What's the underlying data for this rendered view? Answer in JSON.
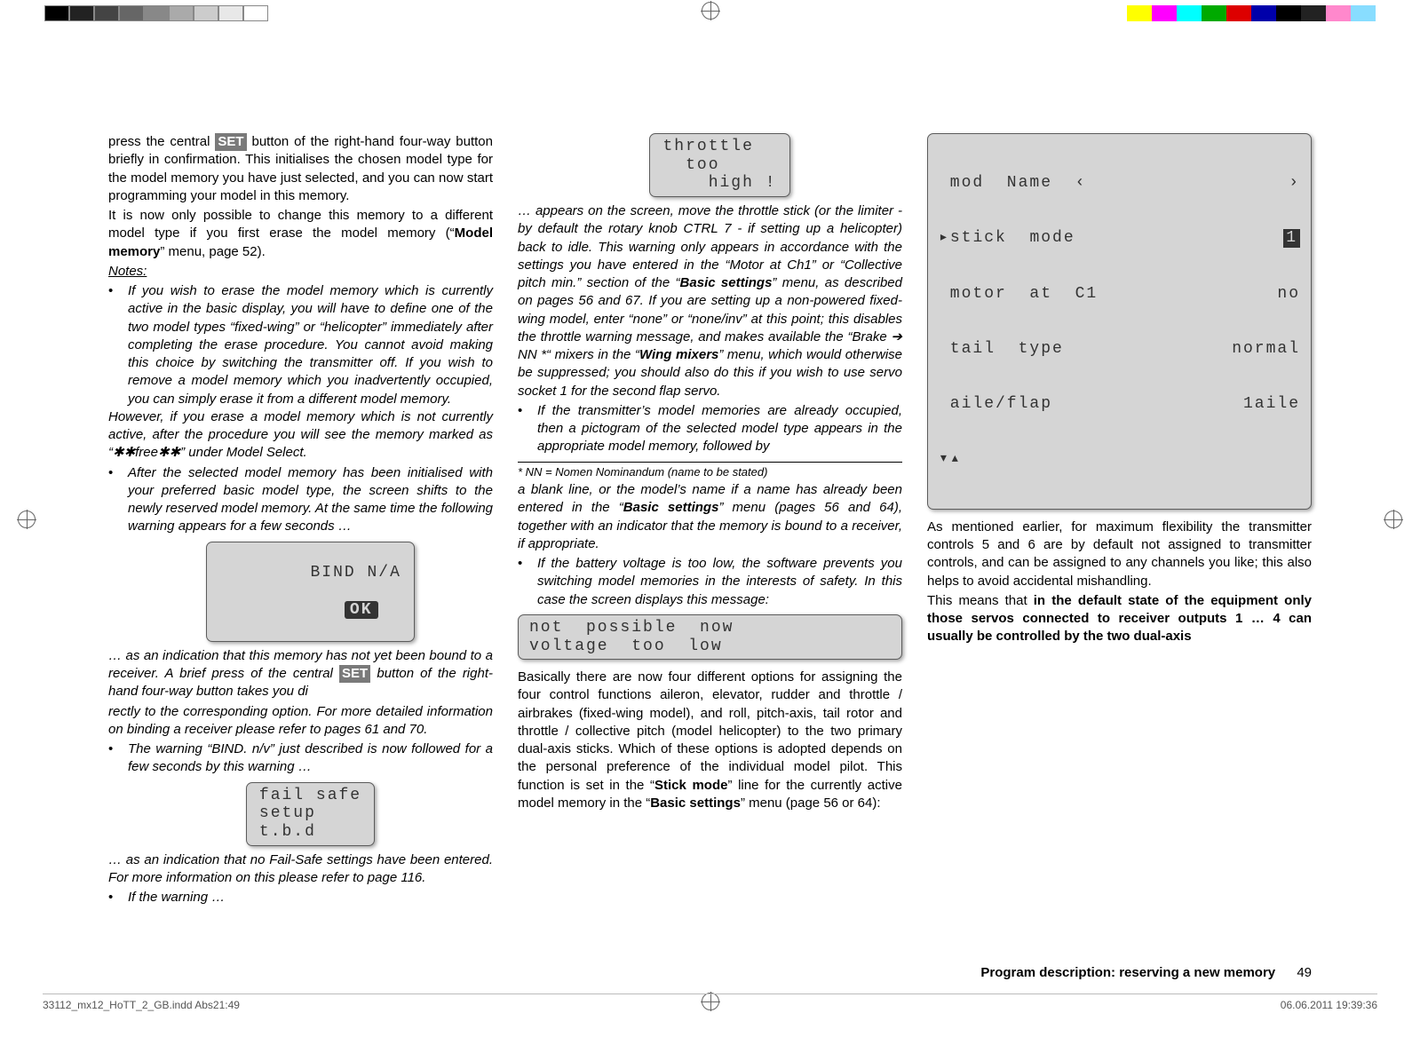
{
  "col1": {
    "p1a": "press the central ",
    "set": "SET",
    "p1b": " button of the right-hand four-way button briefly in confirmation. This initialises the chosen model type for the model memory you have just selected, and you can now start programming your model in this memory.",
    "p2a": "It is now only possible to change this memory to a different model type if you first erase the model memory (“",
    "p2b": "Model memory",
    "p2c": "” menu, page 52).",
    "notes": "Notes:",
    "n1": "If you wish to erase the model memory which is currently active in the basic display, you will have to define one of the two model types “fixed-wing” or “helicopter” immediately after completing the erase procedure. You cannot avoid making this choice by switching the transmitter off. If you wish to remove a model memory which you inadvertently occupied, you can simply erase it from a different model memory.",
    "n1b": "However, if you erase a model memory which is not currently active, after the procedure you will see the memory marked as “✱✱free✱✱” under Model Select.",
    "n2": "After the selected model memory has been initialised with your preferred basic model type, the screen shifts to the newly reserved model memory. At the same time the following warning appears for a few seconds …",
    "lcd1a": "BIND N/A",
    "lcd1_ok": "OK",
    "n2b_a": "… as an indication that this memory has not yet been bound to a receiver. A brief press of the central ",
    "n2b_b": " button of the right-hand four-way button takes you di"
  },
  "col2": {
    "n2c": "rectly to the corresponding option. For more detailed information on binding a receiver please refer to pages 61 and 70.",
    "n3": "The warning “BIND. n/v” just described is now followed for a few seconds by this warning …",
    "lcd2": "fail safe\nsetup\nt.b.d",
    "n3b": "… as an indication that no Fail-Safe settings have been entered. For more information on this please refer to page 116.",
    "n4": "If the warning …",
    "lcd3": "throttle\n  too\n    high !",
    "n4b_a": "… appears on the screen, move the throttle stick (or the limiter - by default the rotary knob CTRL 7 - if setting up a helicopter) back to idle. This warning only appears in accordance with the settings you have entered in the “Motor at Ch1” or “Collective pitch min.” section of the “",
    "n4b_bs": "Basic settings",
    "n4b_b": "” menu, as described on pages 56 and 67. If you are setting up a non-powered fixed-wing model, enter “none” or “none/inv” at this point; this disables the throttle warning message, and makes available the “Brake ➔ NN *“ mixers in the “",
    "n4b_wm": "Wing mixers",
    "n4b_c": "” menu, which would otherwise be suppressed; you should also do this if you wish to use servo socket 1 for the second flap servo.",
    "n5": "If the transmitter’s model memories are already occupied, then a pictogram of the selected model type appears in the appropriate model memory, followed by",
    "foot": "*    NN = Nomen Nominandum (name to be stated)"
  },
  "col3": {
    "n5b_a": "a blank line, or the model’s name if a name has already been entered in the “",
    "n5b_bs": "Basic settings",
    "n5b_b": "” menu (pages 56 and 64), together with an indicator that the memory is bound to a receiver, if appropriate.",
    "n6": "If the battery voltage is too low, the software prevents you switching model memories in the interests of safety. In this case the screen displays this message:",
    "lcd4": "not  possible  now\nvoltage  too  low",
    "p3a": "Basically there are now four different options for assigning the four control functions aileron, elevator, rudder and throttle / airbrakes (fixed-wing model), and roll, pitch-axis, tail rotor and throttle / collective pitch (model helicopter) to the two primary dual-axis sticks. Which of these options is adopted depends on the personal preference of the individual model pilot. This function is set in the “",
    "p3_sm": "Stick mode",
    "p3b": "” line for the currently active model memory in the “",
    "p3_bs": "Basic settings",
    "p3c": "” menu (page 56 or 64):",
    "menu": {
      "r1l": " mod  Name  ‹",
      "r1r": "›",
      "r2l": "▸stick  mode",
      "r2r": "1",
      "r3l": " motor  at  C1",
      "r3r": "no",
      "r4l": " tail  type",
      "r4r": "normal",
      "r5l": " aile/flap",
      "r5r": "1aile",
      "arrows": "▾▴"
    },
    "p4": "As mentioned earlier, for maximum flexibility the transmitter controls 5 and 6 are by default not assigned to transmitter controls, and can be assigned to any channels you like; this also helps to avoid accidental mishandling.",
    "p5a": "This means that ",
    "p5b": "in the default state of the equipment only those servos connected to receiver outputs 1 … 4 can usually be controlled by the two dual-axis"
  },
  "footer": {
    "section": "Program description: reserving a new memory",
    "page": "49"
  },
  "imprint": {
    "left": "33112_mx12_HoTT_2_GB.indd   Abs21:49",
    "right": "06.06.2011   19:39:36"
  }
}
